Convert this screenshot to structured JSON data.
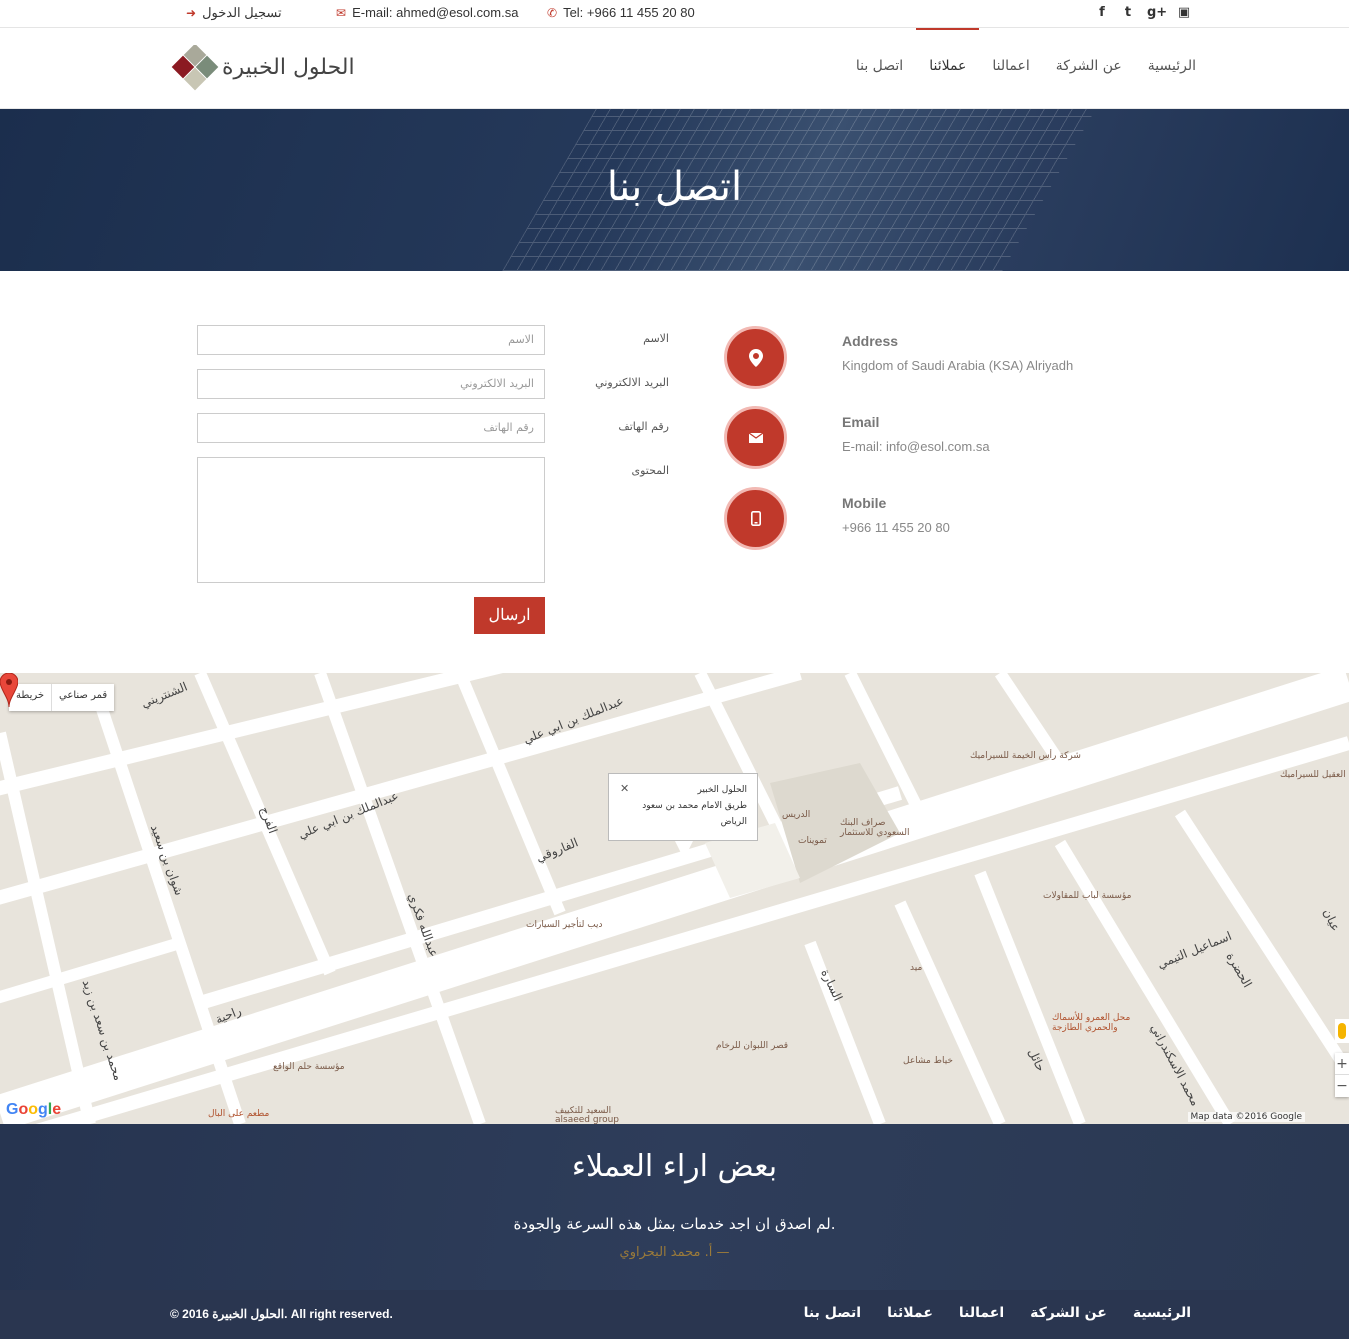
{
  "topbar": {
    "login": "تسجيل الدخول",
    "email": "E-mail:  ahmed@esol.com.sa",
    "tel": "Tel: +966 11 455 20 80",
    "social_icons": [
      "facebook-icon",
      "twitter-icon",
      "google-plus-icon",
      "youtube-icon"
    ]
  },
  "logo": {
    "text": "الحلول الخبيرة"
  },
  "nav": {
    "items": [
      "الرئيسية",
      "عن الشركة",
      "اعمالنا",
      "عملائنا",
      "اتصل بنا"
    ],
    "active_index": 3
  },
  "banner": {
    "title": "اتصل بنا"
  },
  "form": {
    "name_label": "الاسم",
    "name_placeholder": "الاسم",
    "email_label": "البريد الالكتروني",
    "email_placeholder": "البريد الالكتروني",
    "phone_label": "رقم الهاتف",
    "phone_placeholder": "رقم الهاتف",
    "content_label": "المحتوى",
    "submit": "ارسال"
  },
  "contact": {
    "address_title": "Address",
    "address_value": "Kingdom of Saudi Arabia (KSA) Alriyadh",
    "email_title": "Email",
    "email_value": "E-mail: info@esol.com.sa",
    "mobile_title": "Mobile",
    "mobile_value": "+966 11 455 20 80"
  },
  "map": {
    "type_map": "خريطة",
    "type_satellite": "قمر صناعي",
    "info_lines": [
      "الحلول الخبير",
      "طريق الامام محمد بن سعود",
      "الرياض"
    ],
    "google": "Google",
    "map_data": "Map data ©2016 Google",
    "zoom_in": "+",
    "zoom_out": "−",
    "streets": [
      "عبدالملك بن ابي علي",
      "عبدالملك بن ابي علي",
      "شوان بن سعيد",
      "عبدالله فكري",
      "راحية",
      "محمد بن سعد بن زيد",
      "الفرج",
      "الشنتريني",
      "اسماعيل التيمي",
      "الحضرة",
      "محمد الاسكندراني",
      "حائل",
      "السارة",
      "عيان"
    ],
    "pois": [
      "شركة رأس الخيمة للسيراميك",
      "محمد العقيل للسيراميك",
      "الدريس",
      "صراف البنك السعودي للاستثمار",
      "تموينات",
      "مؤسسة لباب للمقاولات",
      "ديب لتأجير السيارات",
      "ميد",
      "محل العمرو للأسماك والحمري الطازجة",
      "قصر اللبوان للرخام",
      "خياط مشاعل",
      "مؤسسة حلم الواقع",
      "مطعم على البال",
      "السعيد للتكييف alsaeed group",
      "الفاروقي"
    ]
  },
  "testimonials": {
    "title": "بعض اراء العملاء",
    "quote": "لم اصدق ان اجد خدمات بمثل هذه السرعة والجودة.",
    "author": "أ. محمد البحراوي —"
  },
  "footer": {
    "copyright": "© 2016 الحلول الخبيرة. All right reserved.",
    "nav": [
      "الرئيسية",
      "عن الشركة",
      "اعمالنا",
      "عملائنا",
      "اتصل بنا"
    ]
  },
  "colors": {
    "accent": "#c0392b",
    "dark": "#2a3650"
  }
}
